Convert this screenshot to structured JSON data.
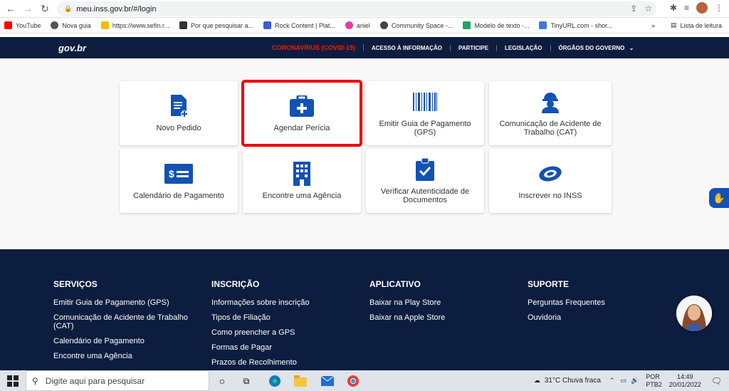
{
  "browser": {
    "url": "meu.inss.gov.br/#/login",
    "bookmarks": [
      {
        "label": "YouTube",
        "color": "#ff0000"
      },
      {
        "label": "Nova guia",
        "color": "#555555"
      },
      {
        "label": "https://www.sefin.r...",
        "color": "#f0c000"
      },
      {
        "label": "Por que pesquisar a...",
        "color": "#333333"
      },
      {
        "label": "Rock Content | Plat...",
        "color": "#3b5bdb"
      },
      {
        "label": "aniel",
        "color": "#e040a0"
      },
      {
        "label": "Community Space -...",
        "color": "#444444"
      },
      {
        "label": "Modelo de texto -...",
        "color": "#1fa463"
      },
      {
        "label": "TinyURL.com - shor...",
        "color": "#3a7bd5"
      }
    ],
    "reading_list": "Lista de leitura"
  },
  "govbar": {
    "logo": "gov.br",
    "links": [
      "CORONAVÍRUS (COVID-19)",
      "ACESSO À INFORMAÇÃO",
      "PARTICIPE",
      "LEGISLAÇÃO",
      "ÓRGÃOS DO GOVERNO"
    ]
  },
  "main": {
    "cards": [
      {
        "label": "Novo Pedido",
        "icon": "document-plus-icon"
      },
      {
        "label": "Agendar Perícia",
        "icon": "medical-kit-icon"
      },
      {
        "label": "Emitir Guia de Pagamento (GPS)",
        "icon": "barcode-icon"
      },
      {
        "label": "Comunicação de Acidente de Trabalho (CAT)",
        "icon": "worker-helmet-icon"
      },
      {
        "label": "Calendário de Pagamento",
        "icon": "money-bill-icon"
      },
      {
        "label": "Encontre uma Agência",
        "icon": "building-icon"
      },
      {
        "label": "Verificar Autenticidade de Documentos",
        "icon": "clipboard-check-icon"
      },
      {
        "label": "Inscrever no INSS",
        "icon": "inss-logo-icon"
      }
    ]
  },
  "footer": {
    "columns": [
      {
        "title": "SERVIÇOS",
        "items": [
          "Emitir Guia de Pagamento (GPS)",
          "Comunicação de Acidente de Trabalho (CAT)",
          "Calendário de Pagamento",
          "Encontre uma Agência"
        ]
      },
      {
        "title": "INSCRIÇÃO",
        "items": [
          "Informações sobre inscrição",
          "Tipos de Filiação",
          "Como preencher a GPS",
          "Formas de Pagar",
          "Prazos de Recolhimento"
        ]
      },
      {
        "title": "APLICATIVO",
        "items": [
          "Baixar na Play Store",
          "Baixar na Apple Store"
        ]
      },
      {
        "title": "SUPORTE",
        "items": [
          "Perguntas Frequentes",
          "Ouvidoria"
        ]
      }
    ]
  },
  "taskbar": {
    "search_placeholder": "Digite aqui para pesquisar",
    "weather": "31°C  Chuva fraca",
    "lang1": "POR",
    "lang2": "PTB2",
    "time": "14:49",
    "date": "20/01/2022"
  },
  "colors": {
    "govbar": "#0c1d3f",
    "accent": "#1351b4",
    "covid": "#e52207",
    "highlight": "#e00000"
  }
}
